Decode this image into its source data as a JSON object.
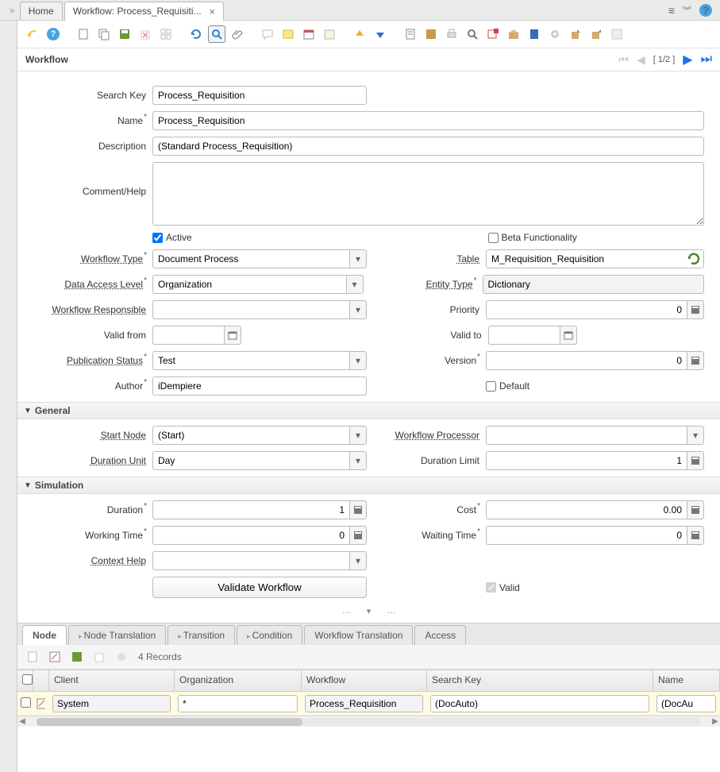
{
  "tabs": {
    "home": "Home",
    "active": "Workflow: Process_Requisiti..."
  },
  "pageTitle": "Workflow",
  "pager": "[ 1/2 ]",
  "fields": {
    "searchKey": {
      "label": "Search Key",
      "value": "Process_Requisition"
    },
    "name": {
      "label": "Name",
      "value": "Process_Requisition"
    },
    "description": {
      "label": "Description",
      "value": "(Standard Process_Requisition)"
    },
    "commentHelp": {
      "label": "Comment/Help",
      "value": ""
    },
    "active": {
      "label": "Active"
    },
    "betaFunc": {
      "label": "Beta Functionality"
    },
    "workflowType": {
      "label": "Workflow Type",
      "value": "Document Process"
    },
    "table": {
      "label": "Table",
      "value": "M_Requisition_Requisition"
    },
    "dataAccess": {
      "label": "Data Access Level",
      "value": "Organization"
    },
    "entityType": {
      "label": "Entity Type",
      "value": "Dictionary"
    },
    "wfResponsible": {
      "label": "Workflow Responsible",
      "value": ""
    },
    "priority": {
      "label": "Priority",
      "value": "0"
    },
    "validFrom": {
      "label": "Valid from",
      "value": ""
    },
    "validTo": {
      "label": "Valid to",
      "value": ""
    },
    "pubStatus": {
      "label": "Publication Status",
      "value": "Test"
    },
    "version": {
      "label": "Version",
      "value": "0"
    },
    "author": {
      "label": "Author",
      "value": "iDempiere"
    },
    "default": {
      "label": "Default"
    }
  },
  "sections": {
    "general": "General",
    "simulation": "Simulation"
  },
  "general": {
    "startNode": {
      "label": "Start Node",
      "value": "(Start)"
    },
    "wfProcessor": {
      "label": "Workflow Processor",
      "value": ""
    },
    "durationUnit": {
      "label": "Duration Unit",
      "value": "Day"
    },
    "durationLimit": {
      "label": "Duration Limit",
      "value": "1"
    }
  },
  "simulation": {
    "duration": {
      "label": "Duration",
      "value": "1"
    },
    "cost": {
      "label": "Cost",
      "value": "0.00"
    },
    "workingTime": {
      "label": "Working Time",
      "value": "0"
    },
    "waitingTime": {
      "label": "Waiting Time",
      "value": "0"
    },
    "contextHelp": {
      "label": "Context Help",
      "value": ""
    },
    "validateBtn": "Validate Workflow",
    "valid": {
      "label": "Valid"
    }
  },
  "bottomTabs": {
    "node": "Node",
    "nodeTrans": "Node Translation",
    "transition": "Transition",
    "condition": "Condition",
    "wfTrans": "Workflow Translation",
    "access": "Access"
  },
  "records": "4 Records",
  "grid": {
    "headers": {
      "client": "Client",
      "org": "Organization",
      "wf": "Workflow",
      "sk": "Search Key",
      "name": "Name"
    },
    "row": {
      "client": "System",
      "org": "*",
      "wf": "Process_Requisition",
      "sk": "(DocAuto)",
      "name": "(DocAu"
    }
  }
}
